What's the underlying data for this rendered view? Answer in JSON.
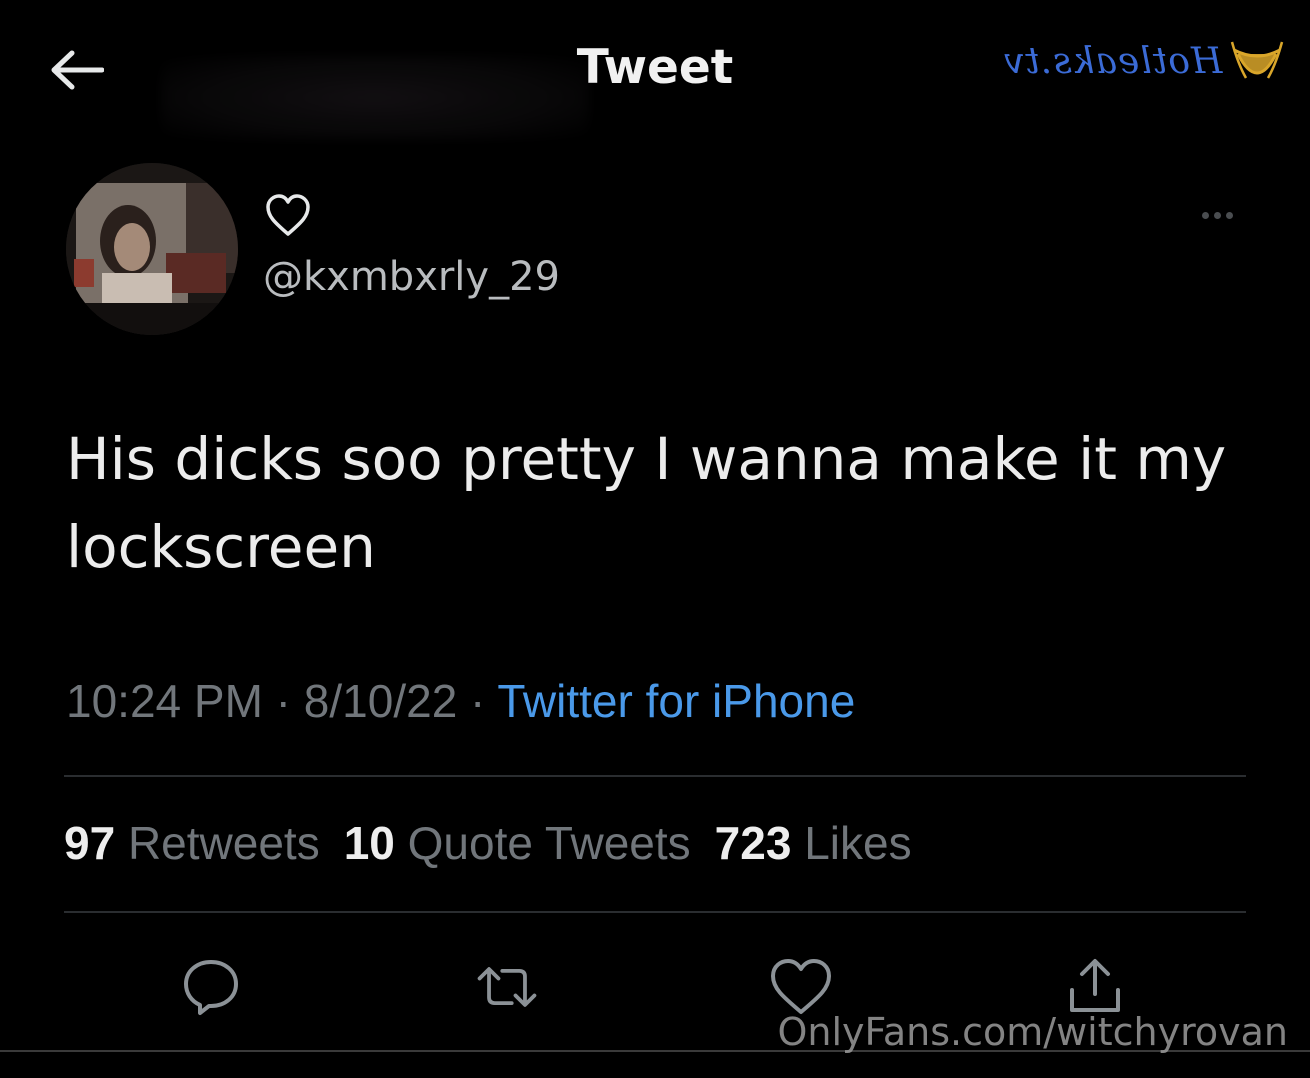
{
  "header": {
    "title": "Tweet",
    "back_icon": "arrow-left-icon",
    "watermark": "Hotleaks.tv"
  },
  "tweet": {
    "author": {
      "handle": "@kxmbxrly_29",
      "avatar": "avatar-photo"
    },
    "text": "His dicks soo pretty I wanna make it my lockscreen",
    "time": "10:24 PM",
    "sep1": " · ",
    "date": "8/10/22",
    "sep2": " · ",
    "source": "Twitter for iPhone"
  },
  "stats": {
    "retweets_count": "97",
    "retweets_label": "Retweets",
    "quotes_count": "10",
    "quotes_label": "Quote Tweets",
    "likes_count": "723",
    "likes_label": "Likes"
  },
  "actions": [
    "reply-icon",
    "retweet-icon",
    "like-icon",
    "share-icon"
  ],
  "footer": {
    "watermark": "OnlyFans.com/witchyrovan"
  },
  "colors": {
    "background": "#000000",
    "link": "#4a99e9",
    "muted": "#71767b",
    "text": "#ececec"
  }
}
